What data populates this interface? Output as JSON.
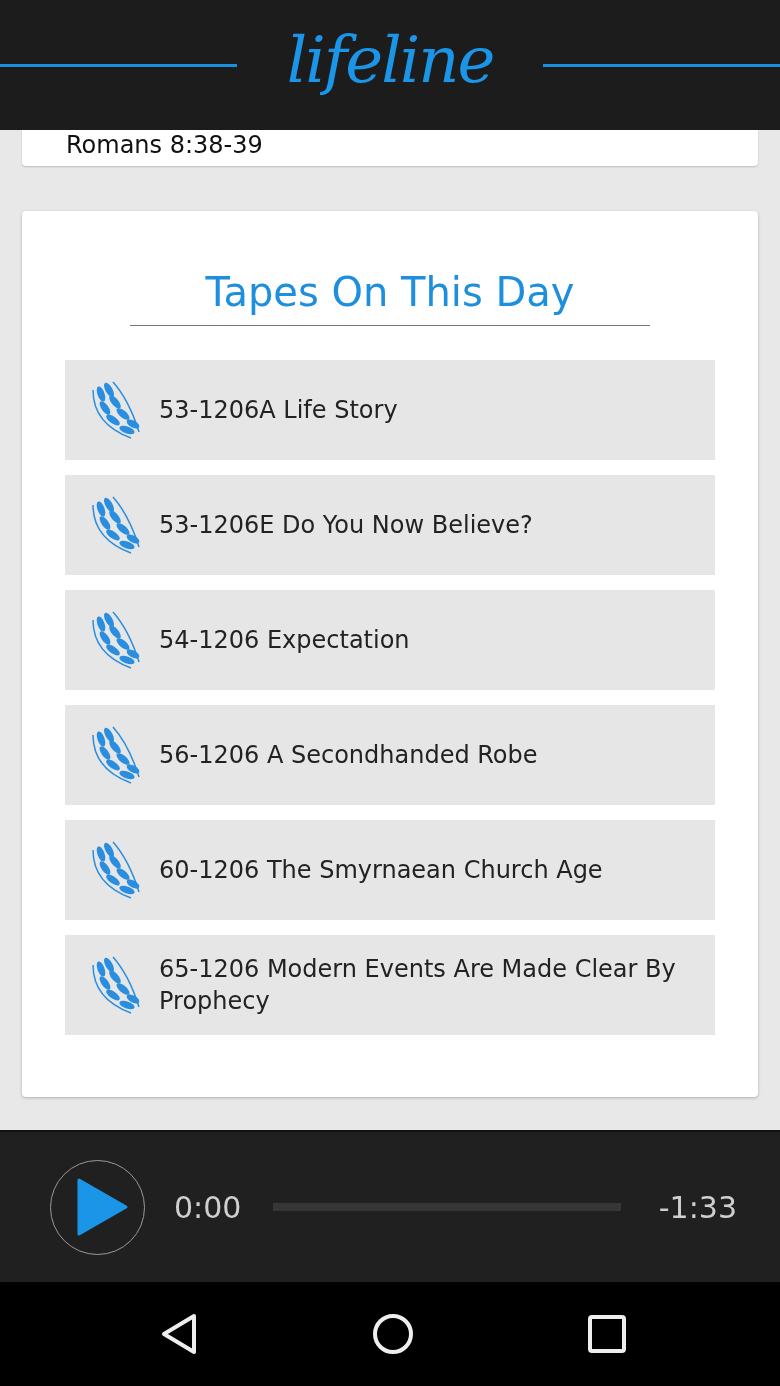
{
  "header": {
    "logo": "lifeline"
  },
  "verse_card": {
    "text": "Romans 8:38-39"
  },
  "tapes_card": {
    "title": "Tapes On This Day",
    "items": [
      {
        "title": "53-1206A Life Story"
      },
      {
        "title": "53-1206E Do You Now Believe?"
      },
      {
        "title": "54-1206 Expectation"
      },
      {
        "title": "56-1206 A Secondhanded Robe"
      },
      {
        "title": "60-1206 The Smyrnaean Church Age"
      },
      {
        "title": "65-1206 Modern Events Are Made Clear By Prophecy"
      }
    ]
  },
  "player": {
    "playing": false,
    "elapsed": "0:00",
    "level": 0,
    "remaining": "-1:33"
  },
  "nav_bar": {
    "buttons": [
      {
        "kind": "back"
      },
      {
        "kind": "home"
      },
      {
        "kind": "recents"
      }
    ]
  }
}
